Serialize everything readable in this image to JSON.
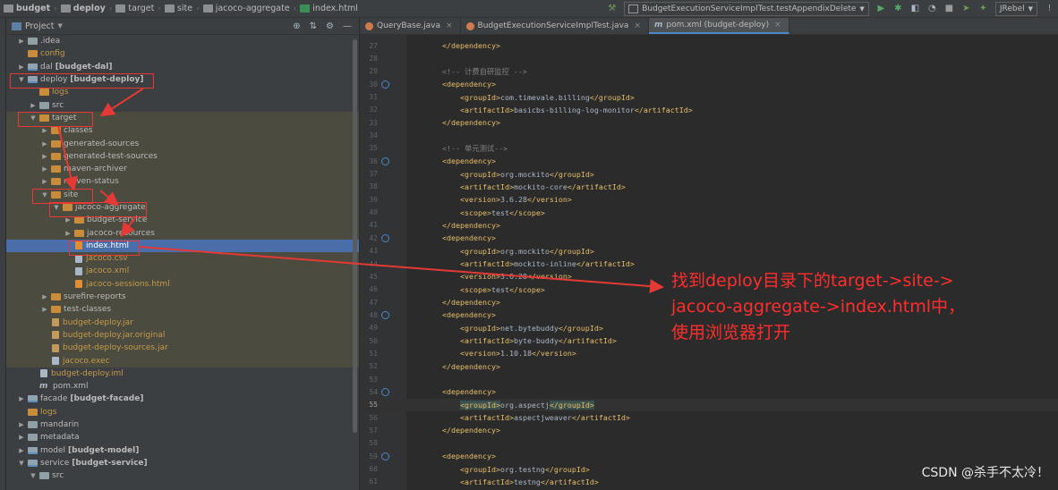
{
  "breadcrumbs": [
    {
      "label": "budget",
      "bold": true
    },
    {
      "label": "deploy",
      "bold": true
    },
    {
      "label": "target",
      "bold": false
    },
    {
      "label": "site",
      "bold": false
    },
    {
      "label": "jacoco-aggregate",
      "bold": false
    },
    {
      "label": "index.html",
      "bold": false
    }
  ],
  "toolbar": {
    "run_config": "BudgetExecutionServiceImplTest.testAppendixDelete",
    "jrebel": "JRebel"
  },
  "project_panel": {
    "title": "Project"
  },
  "tree": [
    {
      "indent": 0,
      "arrow": "▶",
      "icon": "folder",
      "label": ".idea",
      "color": "normal",
      "module": ""
    },
    {
      "indent": 0,
      "arrow": "",
      "icon": "ofolder",
      "label": "config",
      "color": "orange",
      "module": ""
    },
    {
      "indent": 0,
      "arrow": "▶",
      "icon": "mod",
      "label": "dal",
      "color": "normal",
      "module": "[budget-dal]"
    },
    {
      "indent": 0,
      "arrow": "▼",
      "icon": "mod",
      "label": "deploy",
      "color": "normal",
      "module": "[budget-deploy]"
    },
    {
      "indent": 1,
      "arrow": "",
      "icon": "ofolder",
      "label": "logs",
      "color": "orange",
      "module": ""
    },
    {
      "indent": 1,
      "arrow": "▶",
      "icon": "folder",
      "label": "src",
      "color": "normal",
      "module": ""
    },
    {
      "indent": 1,
      "arrow": "▼",
      "icon": "ofolder",
      "label": "target",
      "color": "normal",
      "module": "",
      "hl": true
    },
    {
      "indent": 2,
      "arrow": "▶",
      "icon": "ofolder",
      "label": "classes",
      "color": "normal",
      "module": "",
      "hl": true
    },
    {
      "indent": 2,
      "arrow": "▶",
      "icon": "ofolder",
      "label": "generated-sources",
      "color": "normal",
      "module": "",
      "hl": true
    },
    {
      "indent": 2,
      "arrow": "▶",
      "icon": "ofolder",
      "label": "generated-test-sources",
      "color": "normal",
      "module": "",
      "hl": true
    },
    {
      "indent": 2,
      "arrow": "▶",
      "icon": "ofolder",
      "label": "maven-archiver",
      "color": "normal",
      "module": "",
      "hl": true
    },
    {
      "indent": 2,
      "arrow": "▶",
      "icon": "ofolder",
      "label": "maven-status",
      "color": "normal",
      "module": "",
      "hl": true
    },
    {
      "indent": 2,
      "arrow": "▼",
      "icon": "ofolder",
      "label": "site",
      "color": "normal",
      "module": "",
      "hl": true
    },
    {
      "indent": 3,
      "arrow": "▼",
      "icon": "ofolder",
      "label": "jacoco-aggregate",
      "color": "normal",
      "module": "",
      "hl": true
    },
    {
      "indent": 4,
      "arrow": "▶",
      "icon": "ofolder",
      "label": "budget-service",
      "color": "normal",
      "module": "",
      "hl": true
    },
    {
      "indent": 4,
      "arrow": "▶",
      "icon": "ofolder",
      "label": "jacoco-resources",
      "color": "normal",
      "module": "",
      "hl": true
    },
    {
      "indent": 4,
      "arrow": "",
      "icon": "html",
      "label": "index.html",
      "color": "normal",
      "module": "",
      "sel": true
    },
    {
      "indent": 4,
      "arrow": "",
      "icon": "file",
      "label": "jacoco.csv",
      "color": "orange",
      "module": "",
      "hl": true
    },
    {
      "indent": 4,
      "arrow": "",
      "icon": "file",
      "label": "jacoco.xml",
      "color": "orange",
      "module": "",
      "hl": true
    },
    {
      "indent": 4,
      "arrow": "",
      "icon": "html",
      "label": "jacoco-sessions.html",
      "color": "orange",
      "module": "",
      "hl": true
    },
    {
      "indent": 2,
      "arrow": "▶",
      "icon": "ofolder",
      "label": "surefire-reports",
      "color": "normal",
      "module": "",
      "hl": true
    },
    {
      "indent": 2,
      "arrow": "▶",
      "icon": "ofolder",
      "label": "test-classes",
      "color": "normal",
      "module": "",
      "hl": true
    },
    {
      "indent": 2,
      "arrow": "",
      "icon": "jar",
      "label": "budget-deploy.jar",
      "color": "orange",
      "module": "",
      "hl": true
    },
    {
      "indent": 2,
      "arrow": "",
      "icon": "jar",
      "label": "budget-deploy.jar.original",
      "color": "orange",
      "module": "",
      "hl": true
    },
    {
      "indent": 2,
      "arrow": "",
      "icon": "jar",
      "label": "budget-deploy-sources.jar",
      "color": "orange",
      "module": "",
      "hl": true
    },
    {
      "indent": 2,
      "arrow": "",
      "icon": "file",
      "label": "jacoco.exec",
      "color": "orange",
      "module": "",
      "hl": true
    },
    {
      "indent": 1,
      "arrow": "",
      "icon": "file",
      "label": "budget-deploy.iml",
      "color": "orange",
      "module": ""
    },
    {
      "indent": 1,
      "arrow": "",
      "icon": "maven",
      "label": "pom.xml",
      "color": "normal",
      "module": ""
    },
    {
      "indent": 0,
      "arrow": "▶",
      "icon": "mod",
      "label": "facade",
      "color": "normal",
      "module": "[budget-facade]"
    },
    {
      "indent": 0,
      "arrow": "",
      "icon": "ofolder",
      "label": "logs",
      "color": "orange",
      "module": ""
    },
    {
      "indent": 0,
      "arrow": "▶",
      "icon": "folder",
      "label": "mandarin",
      "color": "normal",
      "module": ""
    },
    {
      "indent": 0,
      "arrow": "▶",
      "icon": "folder",
      "label": "metadata",
      "color": "normal",
      "module": ""
    },
    {
      "indent": 0,
      "arrow": "▶",
      "icon": "mod",
      "label": "model",
      "color": "normal",
      "module": "[budget-model]"
    },
    {
      "indent": 0,
      "arrow": "▼",
      "icon": "mod",
      "label": "service",
      "color": "normal",
      "module": "[budget-service]"
    },
    {
      "indent": 1,
      "arrow": "▼",
      "icon": "folder",
      "label": "src",
      "color": "normal",
      "module": ""
    }
  ],
  "editor_tabs": [
    {
      "label": "QueryBase.java",
      "icon": "j",
      "active": false
    },
    {
      "label": "BudgetExecutionServiceImplTest.java",
      "icon": "j",
      "active": false
    },
    {
      "label": "pom.xml (budget-deploy)",
      "icon": "m",
      "active": true
    }
  ],
  "code_lines": [
    {
      "n": "27",
      "indent": 8,
      "parts": [
        [
          "tag",
          "</dependency>"
        ]
      ],
      "mark": false
    },
    {
      "n": "28",
      "indent": 0,
      "parts": [],
      "mark": false
    },
    {
      "n": "29",
      "indent": 8,
      "parts": [
        [
          "cmt",
          "<!-- 计费自研监控 -->"
        ]
      ],
      "mark": false
    },
    {
      "n": "30",
      "indent": 8,
      "parts": [
        [
          "tag",
          "<dependency>"
        ]
      ],
      "mark": true
    },
    {
      "n": "31",
      "indent": 12,
      "parts": [
        [
          "tag",
          "<groupId>"
        ],
        [
          "txt",
          "com.timevale.billing"
        ],
        [
          "tag",
          "</groupId>"
        ]
      ],
      "mark": false
    },
    {
      "n": "32",
      "indent": 12,
      "parts": [
        [
          "tag",
          "<artifactId>"
        ],
        [
          "txt",
          "basicbs-billing-log-monitor"
        ],
        [
          "tag",
          "</artifactId>"
        ]
      ],
      "mark": false
    },
    {
      "n": "33",
      "indent": 8,
      "parts": [
        [
          "tag",
          "</dependency>"
        ]
      ],
      "mark": false
    },
    {
      "n": "34",
      "indent": 0,
      "parts": [],
      "mark": false
    },
    {
      "n": "35",
      "indent": 8,
      "parts": [
        [
          "cmt",
          "<!-- 单元测试-->"
        ]
      ],
      "mark": false
    },
    {
      "n": "36",
      "indent": 8,
      "parts": [
        [
          "tag",
          "<dependency>"
        ]
      ],
      "mark": true
    },
    {
      "n": "37",
      "indent": 12,
      "parts": [
        [
          "tag",
          "<groupId>"
        ],
        [
          "txt",
          "org.mockito"
        ],
        [
          "tag",
          "</groupId>"
        ]
      ],
      "mark": false
    },
    {
      "n": "38",
      "indent": 12,
      "parts": [
        [
          "tag",
          "<artifactId>"
        ],
        [
          "txt",
          "mockito-core"
        ],
        [
          "tag",
          "</artifactId>"
        ]
      ],
      "mark": false
    },
    {
      "n": "39",
      "indent": 12,
      "parts": [
        [
          "tag",
          "<version>"
        ],
        [
          "txt",
          "3.6.28"
        ],
        [
          "tag",
          "</version>"
        ]
      ],
      "mark": false
    },
    {
      "n": "40",
      "indent": 12,
      "parts": [
        [
          "tag",
          "<scope>"
        ],
        [
          "txt",
          "test"
        ],
        [
          "tag",
          "</scope>"
        ]
      ],
      "mark": false
    },
    {
      "n": "41",
      "indent": 8,
      "parts": [
        [
          "tag",
          "</dependency>"
        ]
      ],
      "mark": false
    },
    {
      "n": "42",
      "indent": 8,
      "parts": [
        [
          "tag",
          "<dependency>"
        ]
      ],
      "mark": true
    },
    {
      "n": "43",
      "indent": 12,
      "parts": [
        [
          "tag",
          "<groupId>"
        ],
        [
          "txt",
          "org.mockito"
        ],
        [
          "tag",
          "</groupId>"
        ]
      ],
      "mark": false
    },
    {
      "n": "44",
      "indent": 12,
      "parts": [
        [
          "tag",
          "<artifactId>"
        ],
        [
          "txt",
          "mockito-inline"
        ],
        [
          "tag",
          "</artifactId>"
        ]
      ],
      "mark": false
    },
    {
      "n": "45",
      "indent": 12,
      "parts": [
        [
          "tag",
          "<version>"
        ],
        [
          "txt",
          "3.6.28"
        ],
        [
          "tag",
          "</version>"
        ]
      ],
      "mark": false
    },
    {
      "n": "46",
      "indent": 12,
      "parts": [
        [
          "tag",
          "<scope>"
        ],
        [
          "txt",
          "test"
        ],
        [
          "tag",
          "</scope>"
        ]
      ],
      "mark": false
    },
    {
      "n": "47",
      "indent": 8,
      "parts": [
        [
          "tag",
          "</dependency>"
        ]
      ],
      "mark": false
    },
    {
      "n": "48",
      "indent": 8,
      "parts": [
        [
          "tag",
          "<dependency>"
        ]
      ],
      "mark": true
    },
    {
      "n": "49",
      "indent": 12,
      "parts": [
        [
          "tag",
          "<groupId>"
        ],
        [
          "txt",
          "net.bytebuddy"
        ],
        [
          "tag",
          "</groupId>"
        ]
      ],
      "mark": false
    },
    {
      "n": "50",
      "indent": 12,
      "parts": [
        [
          "tag",
          "<artifactId>"
        ],
        [
          "txt",
          "byte-buddy"
        ],
        [
          "tag",
          "</artifactId>"
        ]
      ],
      "mark": false
    },
    {
      "n": "51",
      "indent": 12,
      "parts": [
        [
          "tag",
          "<version>"
        ],
        [
          "txt",
          "1.10.18"
        ],
        [
          "tag",
          "</version>"
        ]
      ],
      "mark": false
    },
    {
      "n": "52",
      "indent": 8,
      "parts": [
        [
          "tag",
          "</dependency>"
        ]
      ],
      "mark": false
    },
    {
      "n": "53",
      "indent": 0,
      "parts": [],
      "mark": false
    },
    {
      "n": "54",
      "indent": 8,
      "parts": [
        [
          "tag",
          "<dependency>"
        ]
      ],
      "mark": true
    },
    {
      "n": "55",
      "indent": 12,
      "parts": [
        [
          "tagsel",
          "<groupId>"
        ],
        [
          "txt",
          "org.aspectj"
        ],
        [
          "tagsel",
          "</groupId>"
        ]
      ],
      "mark": false,
      "cur": true
    },
    {
      "n": "56",
      "indent": 12,
      "parts": [
        [
          "tag",
          "<artifactId>"
        ],
        [
          "txt",
          "aspectjweaver"
        ],
        [
          "tag",
          "</artifactId>"
        ]
      ],
      "mark": false
    },
    {
      "n": "57",
      "indent": 8,
      "parts": [
        [
          "tag",
          "</dependency>"
        ]
      ],
      "mark": false
    },
    {
      "n": "58",
      "indent": 0,
      "parts": [],
      "mark": false
    },
    {
      "n": "59",
      "indent": 8,
      "parts": [
        [
          "tag",
          "<dependency>"
        ]
      ],
      "mark": true
    },
    {
      "n": "60",
      "indent": 12,
      "parts": [
        [
          "tag",
          "<groupId>"
        ],
        [
          "txt",
          "org.testng"
        ],
        [
          "tag",
          "</groupId>"
        ]
      ],
      "mark": false
    },
    {
      "n": "61",
      "indent": 12,
      "parts": [
        [
          "tag",
          "<artifactId>"
        ],
        [
          "txt",
          "testng"
        ],
        [
          "tag",
          "</artifactId>"
        ]
      ],
      "mark": false
    }
  ],
  "annotation": {
    "lines": [
      "找到deploy目录下的target->site->",
      "jacoco-aggregate->index.html中，",
      "使用浏览器打开"
    ]
  },
  "watermark": "CSDN @杀手不太冷！",
  "colors": {
    "annotation_red": "#ff2d2d",
    "selection_blue": "#4a6ea9",
    "tag_yellow": "#e8bf6a"
  }
}
